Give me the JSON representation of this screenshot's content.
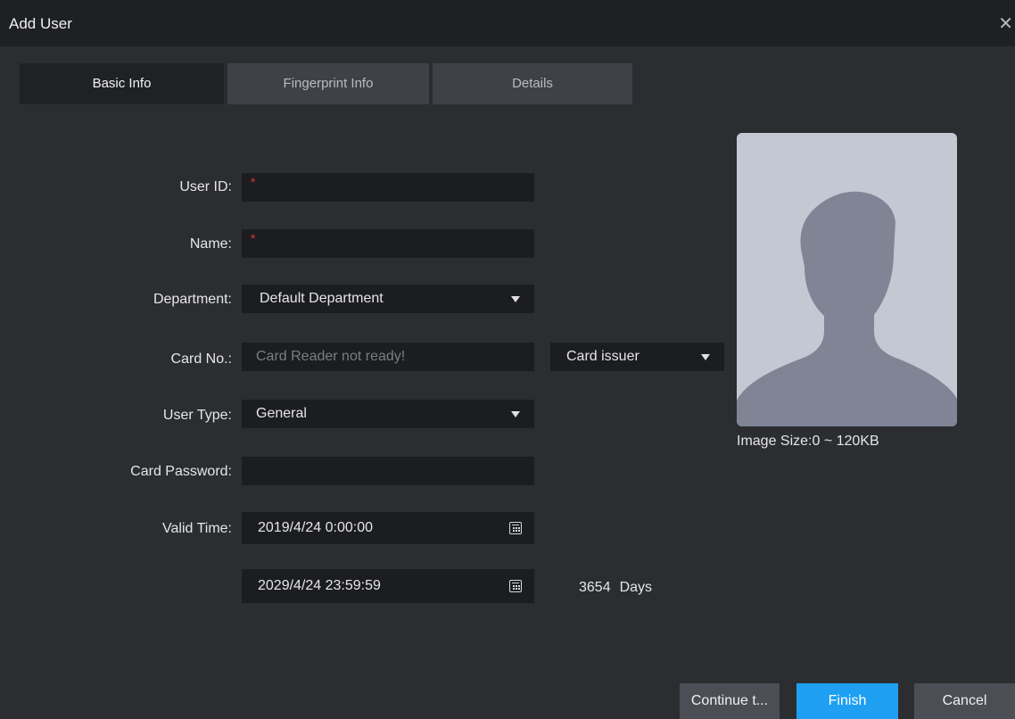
{
  "window": {
    "title": "Add User",
    "close_icon": "close-icon"
  },
  "tabs": [
    {
      "label": "Basic Info",
      "active": true
    },
    {
      "label": "Fingerprint Info",
      "active": false
    },
    {
      "label": "Details",
      "active": false
    }
  ],
  "form": {
    "user_id": {
      "label": "User ID:",
      "value": "",
      "required_mark": "*"
    },
    "name": {
      "label": "Name:",
      "value": "",
      "required_mark": "*"
    },
    "department": {
      "label": "Department:",
      "value": "Default Department"
    },
    "card_no": {
      "label": "Card No.:",
      "placeholder": "Card Reader not ready!"
    },
    "card_issuer": {
      "value": "Card issuer"
    },
    "user_type": {
      "label": "User Type:",
      "value": "General"
    },
    "card_password": {
      "label": "Card Password:",
      "value": ""
    },
    "valid_time": {
      "label": "Valid Time:",
      "start": "2019/4/24 0:00:00",
      "end": "2029/4/24 23:59:59",
      "days_value": "3654",
      "days_unit": "Days"
    }
  },
  "photo": {
    "image_size_text": "Image Size:0 ~ 120KB"
  },
  "buttons": {
    "continue": "Continue t...",
    "finish": "Finish",
    "cancel": "Cancel"
  },
  "colors": {
    "accent": "#1e9ff2",
    "required": "#e0313f",
    "background": "#2b2d31"
  }
}
